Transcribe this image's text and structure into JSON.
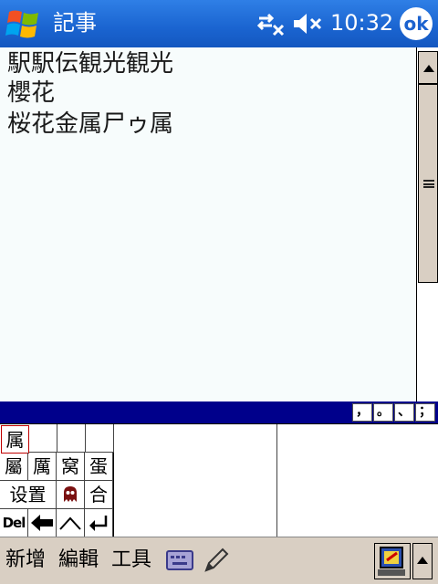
{
  "titlebar": {
    "app_title": "記事",
    "clock": "10:32",
    "ok_label": "ok",
    "start_icon": "windows-flag-icon",
    "connectivity_icon": "connectivity-icon",
    "volume_icon": "speaker-muted-icon",
    "bar_color": "#1a64d0"
  },
  "document": {
    "lines": [
      "駅駅伝観光観光",
      "櫻花",
      "桜花金属尸ゥ属"
    ]
  },
  "input_bar": {
    "punctuation": [
      "，",
      "。",
      "、",
      "；"
    ],
    "bar_color": "#00008b"
  },
  "input_panel": {
    "selected_char": "属",
    "candidates_row1": [
      "屬",
      "厲",
      "窝",
      "蛋"
    ],
    "settings_label": "设置",
    "ghost_icon": "ghost-icon",
    "candidate_extra": "合",
    "del_label": "Del",
    "backspace_icon": "left-arrow-icon",
    "caret_icon": "caret-up-icon",
    "enter_icon": "enter-icon"
  },
  "menubar": {
    "new_label": "新增",
    "edit_label": "編輯",
    "tools_label": "工具",
    "keyboard_icon": "keyboard-icon",
    "pen_icon": "pen-icon",
    "input_method_icon": "input-method-icon",
    "arrow_icon": "up-arrow-icon",
    "bar_color": "#d9cfc3"
  }
}
